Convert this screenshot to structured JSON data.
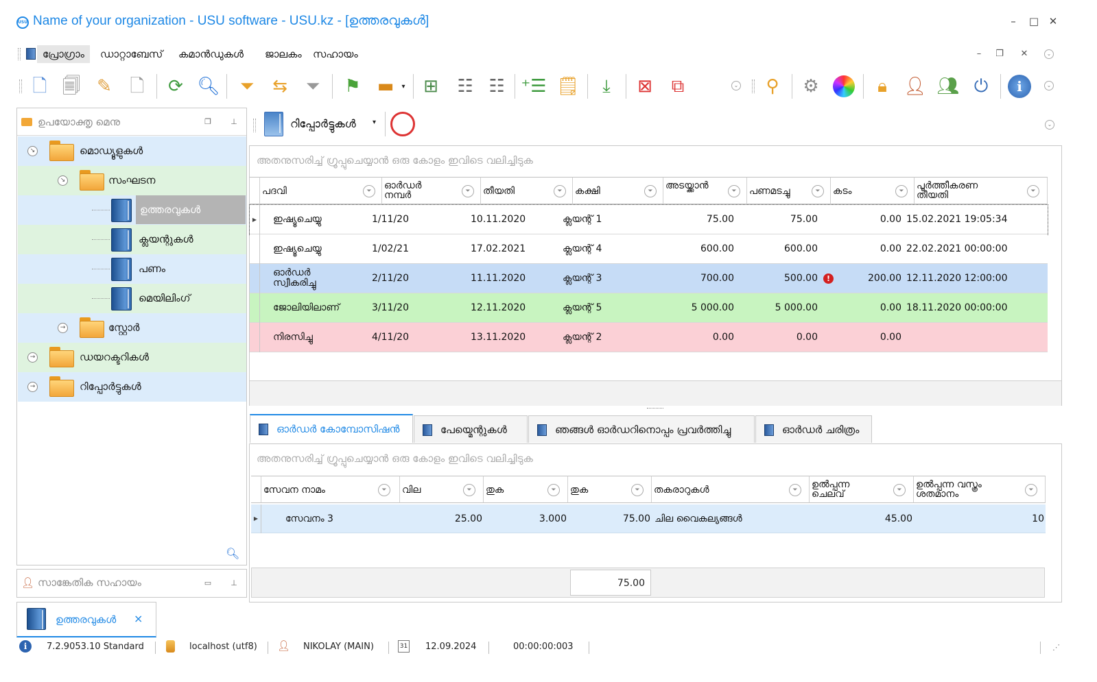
{
  "window": {
    "title": "Name of your organization - USU software - USU.kz - [ഉത്തരവുകൾ]",
    "logo_text": "USU"
  },
  "menu": {
    "items": [
      "പ്രോഗ്രാം",
      "ഡാറ്റാബേസ്",
      "കമാൻഡുകൾ",
      "ജാലകം",
      "സഹായം"
    ]
  },
  "side_panel": {
    "title": "ഉപയോക്തൃ മെനു",
    "tree": [
      {
        "label": "മൊഡ്യൂളുകൾ",
        "type": "folder",
        "level": 0,
        "expanded": true
      },
      {
        "label": "സംഘടന",
        "type": "folder",
        "level": 1,
        "expanded": true
      },
      {
        "label": "ഉത്തരവുകൾ",
        "type": "book",
        "level": 2,
        "selected": true
      },
      {
        "label": "ക്ലയന്റുകൾ",
        "type": "book",
        "level": 2
      },
      {
        "label": "പണം",
        "type": "book",
        "level": 2
      },
      {
        "label": "മെയിലിംഗ്",
        "type": "book",
        "level": 2
      },
      {
        "label": "സ്റ്റോർ",
        "type": "folder",
        "level": 1,
        "expanded": false
      },
      {
        "label": "ഡയറക്ടറികൾ",
        "type": "folder",
        "level": 0,
        "expanded": false
      },
      {
        "label": "റിപ്പോർട്ടുകൾ",
        "type": "folder",
        "level": 0,
        "expanded": false
      }
    ]
  },
  "support_panel": {
    "title": "സാങ്കേതിക സഹായം"
  },
  "reports_toolbar": {
    "label": "റിപ്പോർട്ടുകൾ"
  },
  "orders_grid": {
    "group_hint": "അതനുസരിച്ച് ഗ്രൂപ്പുചെയ്യാൻ ഒരു കോളം ഇവിടെ വലിച്ചിടുക",
    "columns": [
      "പദവി",
      "ഓർഡർ നമ്പർ",
      "തീയതി",
      "കക്ഷി",
      "അടയ്ക്കാൻ",
      "പണമടച്ചു",
      "കടം",
      "പൂർത്തീകരണ തീയതി"
    ],
    "rows": [
      {
        "status": "ഇഷ്യൂചെയ്യു",
        "number": "1/11/20",
        "date": "10.11.2020",
        "client": "ക്ലയന്റ് 1",
        "to_pay": "75.00",
        "paid": "75.00",
        "debt": "0.00",
        "completion": "15.02.2021 19:05:34",
        "color": "white",
        "warning": false
      },
      {
        "status": "ഇഷ്യൂചെയ്യു",
        "number": "1/02/21",
        "date": "17.02.2021",
        "client": "ക്ലയന്റ് 4",
        "to_pay": "600.00",
        "paid": "600.00",
        "debt": "0.00",
        "completion": "22.02.2021 00:00:00",
        "color": "white",
        "warning": false
      },
      {
        "status": "ഓർഡർ സ്വീകരിച്ചു",
        "number": "2/11/20",
        "date": "11.11.2020",
        "client": "ക്ലയന്റ് 3",
        "to_pay": "700.00",
        "paid": "500.00",
        "debt": "200.00",
        "completion": "12.11.2020 12:00:00",
        "color": "#c6dcf6",
        "warning": true
      },
      {
        "status": "ജോലിയിലാണ്",
        "number": "3/11/20",
        "date": "12.11.2020",
        "client": "ക്ലയന്റ് 5",
        "to_pay": "5 000.00",
        "paid": "5 000.00",
        "debt": "0.00",
        "completion": "18.11.2020 00:00:00",
        "color": "#c8f4c0",
        "warning": false
      },
      {
        "status": "നിരസിച്ചു",
        "number": "4/11/20",
        "date": "13.11.2020",
        "client": "ക്ലയന്റ് 2",
        "to_pay": "0.00",
        "paid": "0.00",
        "debt": "0.00",
        "completion": "",
        "color": "#fbd0d6",
        "warning": false
      }
    ]
  },
  "detail_tabs": [
    "ഓർഡർ കോമ്പോസിഷൻ",
    "പേയ്മെന്റുകൾ",
    "ഞങ്ങൾ ഓർഡറിനൊപ്പം പ്രവർത്തിച്ചു",
    "ഓർഡർ ചരിത്രം"
  ],
  "composition_grid": {
    "group_hint": "അതനുസരിച്ച് ഗ്രൂപ്പുചെയ്യാൻ ഒരു കോളം ഇവിടെ വലിച്ചിടുക",
    "columns": [
      "സേവന നാമം",
      "വില",
      "തുക",
      "തുക",
      "തകരാറുകൾ",
      "ഉൽപ്പന്ന ചെലവ്",
      "ഉൽപ്പന്ന വസ്ത്രം ശതമാനം"
    ],
    "rows": [
      {
        "service": "സേവനം 3",
        "price": "25.00",
        "qty": "3.000",
        "amount": "75.00",
        "defects": "ചില വൈകല്യങ്ങൾ",
        "cost": "45.00",
        "wear": "10"
      }
    ],
    "total": "75.00"
  },
  "doc_tab": {
    "label": "ഉത്തരവുകൾ",
    "close": "×"
  },
  "status_bar": {
    "version": "7.2.9053.10 Standard",
    "db": "localhost (utf8)",
    "user": "NIKOLAY (MAIN)",
    "calendar_day": "31",
    "date": "12.09.2024",
    "timer": "00:00:00:003"
  },
  "colors": {
    "accent": "#1e88e5",
    "tree_blue": "#dcecfb",
    "tree_green": "#dff3df",
    "selected_node": "#b4b4b4"
  }
}
